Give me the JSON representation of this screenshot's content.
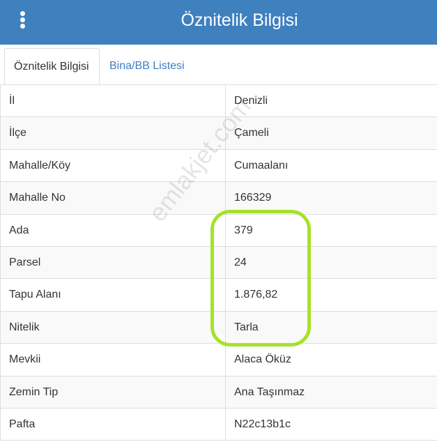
{
  "header": {
    "title": "Öznitelik Bilgisi",
    "menu_icon": "kebab-menu-icon",
    "background_color": "#3f80bf"
  },
  "tabs": [
    {
      "label": "Öznitelik Bilgisi",
      "active": true
    },
    {
      "label": "Bina/BB Listesi",
      "active": false
    }
  ],
  "attributes": [
    {
      "label": "İl",
      "value": "Denizli"
    },
    {
      "label": "İlçe",
      "value": "Çameli"
    },
    {
      "label": "Mahalle/Köy",
      "value": "Cumaalanı"
    },
    {
      "label": "Mahalle No",
      "value": "166329"
    },
    {
      "label": "Ada",
      "value": "379"
    },
    {
      "label": "Parsel",
      "value": "24"
    },
    {
      "label": "Tapu Alanı",
      "value": "1.876,82"
    },
    {
      "label": "Nitelik",
      "value": "Tarla"
    },
    {
      "label": "Mevkii",
      "value": "Alaca Öküz"
    },
    {
      "label": "Zemin Tip",
      "value": "Ana Taşınmaz"
    },
    {
      "label": "Pafta",
      "value": "N22c13b1c"
    }
  ],
  "watermark": "emlakjet.com",
  "highlight_color": "#a6e22a"
}
